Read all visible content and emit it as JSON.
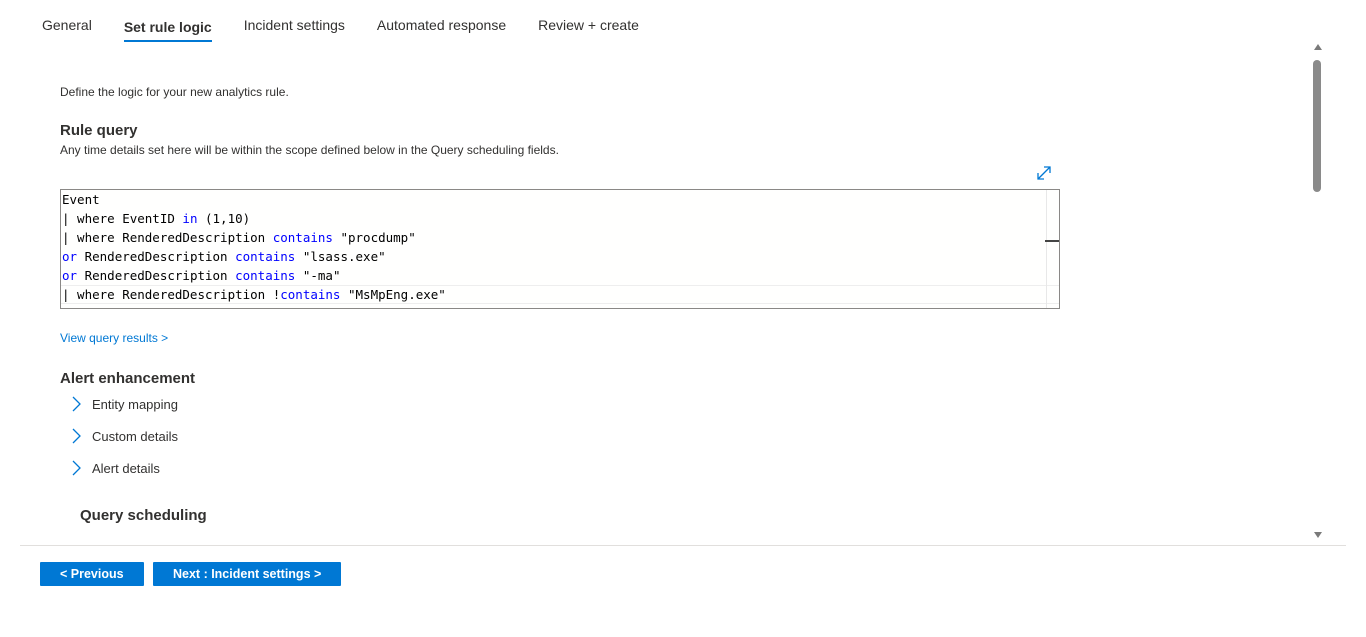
{
  "tabs": [
    {
      "label": "General",
      "active": false
    },
    {
      "label": "Set rule logic",
      "active": true
    },
    {
      "label": "Incident settings",
      "active": false
    },
    {
      "label": "Automated response",
      "active": false
    },
    {
      "label": "Review + create",
      "active": false
    }
  ],
  "intro": "Define the logic for your new analytics rule.",
  "rule_query": {
    "title": "Rule query",
    "subtitle": "Any time details set here will be within the scope defined below in the Query scheduling fields.",
    "expand_icon": "expand-diagonal-icon",
    "lines": [
      {
        "plain1": "Event",
        "kw": "",
        "plain2": ""
      },
      {
        "plain1": "| where EventID ",
        "kw": "in",
        "plain2": " (1,10)"
      },
      {
        "plain1": "| where RenderedDescription ",
        "kw": "contains",
        "plain2": " \"procdump\""
      },
      {
        "plain1": "",
        "kw": "or",
        "plain2": " RenderedDescription "
      },
      {
        "plain1": "",
        "kw": "or",
        "plain2": " RenderedDescription "
      },
      {
        "plain1": "| where RenderedDescription !",
        "kw": "contains",
        "plain2": " \"MsMpEng.exe\""
      }
    ],
    "line4_tail_kw": "contains",
    "line4_tail_str": " \"lsass.exe\"",
    "line5_tail_kw": "contains",
    "line5_tail_str": " \"-ma\"",
    "view_results_link": "View query results >"
  },
  "alert_enhancement": {
    "title": "Alert enhancement",
    "items": [
      {
        "label": "Entity mapping",
        "icon": "chevron-right-icon"
      },
      {
        "label": "Custom details",
        "icon": "chevron-right-icon"
      },
      {
        "label": "Alert details",
        "icon": "chevron-right-icon"
      }
    ]
  },
  "query_scheduling": {
    "title": "Query scheduling"
  },
  "footer": {
    "previous_label": "< Previous",
    "next_label": "Next : Incident settings >"
  },
  "colors": {
    "accent": "#0078d4",
    "keyword": "#0000ff",
    "text": "#323130"
  }
}
